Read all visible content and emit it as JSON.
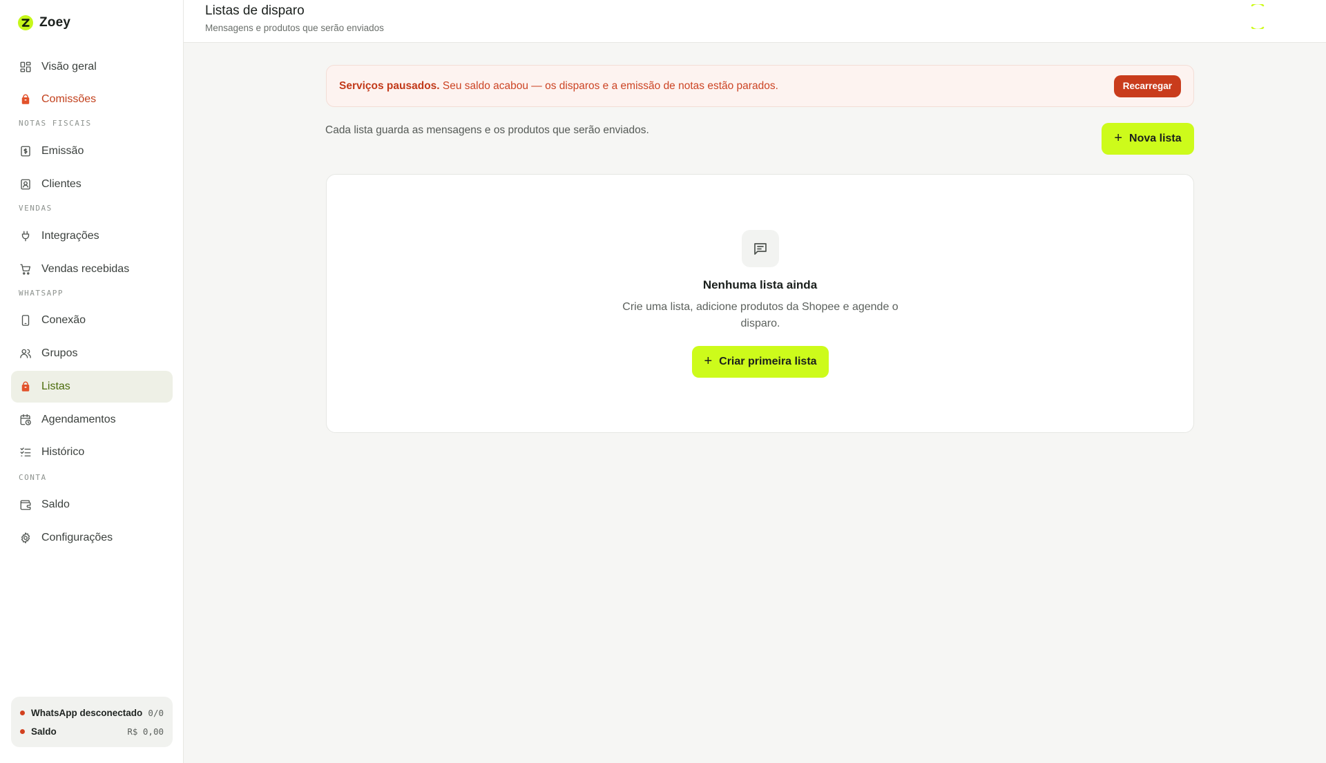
{
  "brand": {
    "name": "Zoey",
    "logo_letter": "Z"
  },
  "sidebar": {
    "items": [
      {
        "label": "Visão geral",
        "icon": "dashboard-grid-icon"
      },
      {
        "label": "Comissões",
        "icon": "shopping-bag-icon",
        "state": "warning"
      },
      {
        "label": "Emissão",
        "icon": "invoice-dollar-icon"
      },
      {
        "label": "Clientes",
        "icon": "contact-card-icon"
      },
      {
        "label": "Integrações",
        "icon": "plug-icon"
      },
      {
        "label": "Vendas recebidas",
        "icon": "shopping-cart-icon"
      },
      {
        "label": "Conexão",
        "icon": "smartphone-icon"
      },
      {
        "label": "Grupos",
        "icon": "users-icon"
      },
      {
        "label": "Listas",
        "icon": "shopping-bag-icon",
        "state": "active"
      },
      {
        "label": "Agendamentos",
        "icon": "calendar-clock-icon"
      },
      {
        "label": "Histórico",
        "icon": "list-checks-icon"
      },
      {
        "label": "Saldo",
        "icon": "wallet-icon"
      },
      {
        "label": "Configurações",
        "icon": "gear-icon"
      }
    ],
    "sections": {
      "notas_fiscais": "NOTAS FISCAIS",
      "vendas": "VENDAS",
      "whatsapp": "WHATSAPP",
      "conta": "CONTA"
    },
    "status": [
      {
        "label": "WhatsApp desconectado",
        "value": "0/0",
        "color": "#d2411f"
      },
      {
        "label": "Saldo",
        "value": "R$ 0,00",
        "color": "#d2411f"
      }
    ]
  },
  "header": {
    "title": "Listas de disparo",
    "subtitle": "Mensagens e produtos que serão enviados"
  },
  "alert": {
    "title": "Serviços pausados.",
    "message": "Seu saldo acabou — os disparos e a emissão de notas estão parados.",
    "button": "Recarregar"
  },
  "main": {
    "intro": "Cada lista guarda as mensagens e os produtos que serão enviados.",
    "new_button": "Nova lista",
    "empty": {
      "title": "Nenhuma lista ainda",
      "description": "Crie uma lista, adicione produtos da Shopee e agende o disparo.",
      "button": "Criar primeira lista",
      "icon": "message-square-icon"
    }
  },
  "colors": {
    "accent": "#cdfb1b",
    "danger": "#c93c1c",
    "active_bg": "#eef0e6",
    "active_text": "#4a6b0a"
  }
}
